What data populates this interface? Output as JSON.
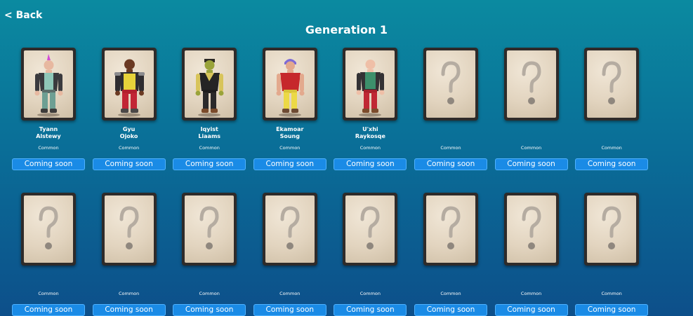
{
  "nav": {
    "back_label": "< Back"
  },
  "page": {
    "title": "Generation 1"
  },
  "colors": {
    "background_top": "#0b8aa0",
    "background_bottom": "#0d4f8a",
    "button": "#1a8be6",
    "card_frame": "#2e2b2a",
    "card_paper": "#e2d4bf"
  },
  "row1": [
    {
      "name_line1": "Tyann",
      "name_line2": "Alstewy",
      "rarity": "Common",
      "button": "Coming soon",
      "icon": "character-portrait"
    },
    {
      "name_line1": "Gyu",
      "name_line2": "Ojoko",
      "rarity": "Common",
      "button": "Coming soon",
      "icon": "character-portrait"
    },
    {
      "name_line1": "Iqyist",
      "name_line2": "Liaams",
      "rarity": "Common",
      "button": "Coming soon",
      "icon": "character-portrait"
    },
    {
      "name_line1": "Ekamoar",
      "name_line2": "Soung",
      "rarity": "Common",
      "button": "Coming soon",
      "icon": "character-portrait"
    },
    {
      "name_line1": "U'xhi",
      "name_line2": "Raykosqe",
      "rarity": "Common",
      "button": "Coming soon",
      "icon": "character-portrait"
    },
    {
      "name_line1": "",
      "name_line2": "",
      "rarity": "Common",
      "button": "Coming soon",
      "icon": "question-mark-icon"
    },
    {
      "name_line1": "",
      "name_line2": "",
      "rarity": "Common",
      "button": "Coming soon",
      "icon": "question-mark-icon"
    },
    {
      "name_line1": "",
      "name_line2": "",
      "rarity": "Common",
      "button": "Coming soon",
      "icon": "question-mark-icon"
    }
  ],
  "row2": [
    {
      "rarity": "Common",
      "button": "Coming soon",
      "icon": "question-mark-icon"
    },
    {
      "rarity": "Common",
      "button": "Coming soon",
      "icon": "question-mark-icon"
    },
    {
      "rarity": "Common",
      "button": "Coming soon",
      "icon": "question-mark-icon"
    },
    {
      "rarity": "Common",
      "button": "Coming soon",
      "icon": "question-mark-icon"
    },
    {
      "rarity": "Common",
      "button": "Coming soon",
      "icon": "question-mark-icon"
    },
    {
      "rarity": "Common",
      "button": "Coming soon",
      "icon": "question-mark-icon"
    },
    {
      "rarity": "Common",
      "button": "Coming soon",
      "icon": "question-mark-icon"
    },
    {
      "rarity": "Common",
      "button": "Coming soon",
      "icon": "question-mark-icon"
    }
  ]
}
